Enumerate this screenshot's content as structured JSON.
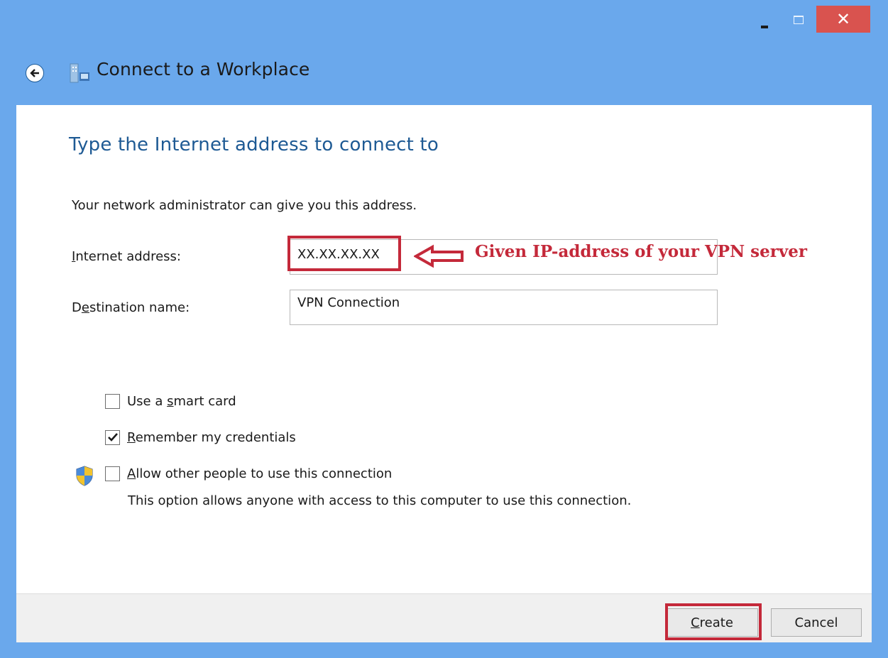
{
  "window": {
    "title": "Connect to a Workplace",
    "controls": {
      "minimize": "minimize",
      "maximize": "maximize",
      "close": "✕"
    }
  },
  "page": {
    "heading": "Type the Internet address to connect to",
    "hint": "Your network administrator can give you this address."
  },
  "fields": {
    "internet_address": {
      "label_pre": "",
      "label_ul": "I",
      "label_post": "nternet address:",
      "value": "XX.XX.XX.XX"
    },
    "destination_name": {
      "label_pre": "D",
      "label_ul": "e",
      "label_post": "stination name:",
      "value": "VPN Connection"
    }
  },
  "annotation": {
    "text": "Given IP-address of your VPN server",
    "color": "#c4293a"
  },
  "options": {
    "smart_card": {
      "pre": "Use a ",
      "ul": "s",
      "post": "mart card",
      "checked": false
    },
    "remember": {
      "pre": "",
      "ul": "R",
      "post": "emember my credentials",
      "checked": true
    },
    "allow_others": {
      "pre": "",
      "ul": "A",
      "post": "llow other people to use this connection",
      "checked": false
    },
    "allow_note": "This option allows anyone with access to this computer to use this connection."
  },
  "footer": {
    "create": {
      "ul": "C",
      "post": "reate"
    },
    "cancel": "Cancel"
  },
  "colors": {
    "title_bar": "#6aa8ec",
    "heading": "#1e5a94",
    "close_button": "#d9534f"
  }
}
